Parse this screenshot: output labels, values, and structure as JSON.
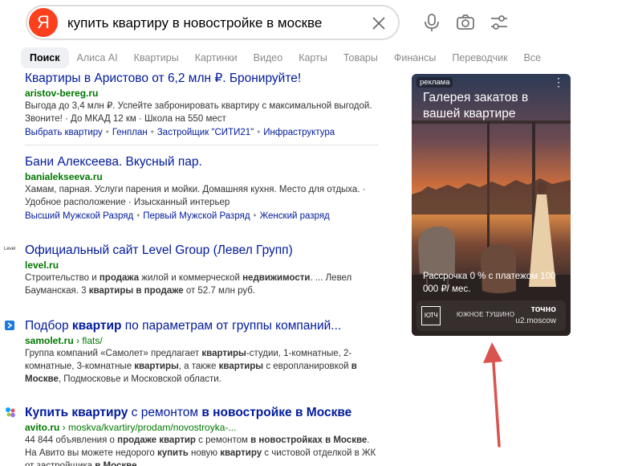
{
  "search": {
    "logo_letter": "Я",
    "query": "купить квартиру в новостройке в москве"
  },
  "tabs": [
    {
      "label": "Поиск",
      "active": true
    },
    {
      "label": "Алиса AI"
    },
    {
      "label": "Квартиры"
    },
    {
      "label": "Картинки"
    },
    {
      "label": "Видео"
    },
    {
      "label": "Карты"
    },
    {
      "label": "Товары"
    },
    {
      "label": "Финансы"
    },
    {
      "label": "Переводчик"
    },
    {
      "label": "Все"
    }
  ],
  "results": [
    {
      "title": "Квартиры в Аристово от 6,2 млн ₽. Бронируйте!",
      "domain": "aristov-bereg.ru",
      "text": "Выгода до 3,4 млн ₽. Успейте забронировать квартиру с максимальной выгодой. Звоните! · До МКАД 12 км · Школа на 550 мест",
      "links": [
        "Выбрать квартиру",
        "Генплан",
        "Застройщик \"СИТИ21\"",
        "Инфраструктура"
      ]
    },
    {
      "title": "Бани Алексеева. Вкусный пар.",
      "domain": "banialekseeva.ru",
      "text": "Хамам, парная. Услуги парения и мойки. Домашняя кухня. Место для отдыха. · Удобное расположение · Изысканный интерьер",
      "links": [
        "Высший Мужской Разряд",
        "Первый Мужской Разряд",
        "Женский разряд"
      ]
    },
    {
      "favicon_text": "Level",
      "title": "Официальный сайт Level Group (Левел Групп)",
      "domain": "level.ru",
      "text_parts": [
        {
          "t": "Строительство и "
        },
        {
          "t": "продажа",
          "b": true
        },
        {
          "t": " жилой и коммерческой "
        },
        {
          "t": "недвижимости",
          "b": true
        },
        {
          "t": ". ... Левел Бауманская. 3 "
        },
        {
          "t": "квартиры в продаже",
          "b": true
        },
        {
          "t": " от 52.7 млн руб."
        }
      ]
    },
    {
      "title_parts": [
        {
          "t": "Подбор "
        },
        {
          "t": "квартир",
          "b": true
        },
        {
          "t": " по параметрам от группы компаний..."
        }
      ],
      "domain": "samolet.ru",
      "path": " › flats/",
      "text_parts": [
        {
          "t": "Группа компаний «Самолет» предлагает "
        },
        {
          "t": "квартиры",
          "b": true
        },
        {
          "t": "-студии, 1-комнатные, 2-комнатные, 3-комнатные "
        },
        {
          "t": "квартиры",
          "b": true
        },
        {
          "t": ", а также "
        },
        {
          "t": "квартиры",
          "b": true
        },
        {
          "t": " с европланировкой "
        },
        {
          "t": "в Москве",
          "b": true
        },
        {
          "t": ", Подмосковье и Московской области."
        }
      ]
    },
    {
      "title_parts": [
        {
          "t": "Купить квартиру",
          "b": true
        },
        {
          "t": " с ремонтом "
        },
        {
          "t": "в новостройке в Москве",
          "b": true
        }
      ],
      "domain": "avito.ru",
      "path": " › moskva/kvartiry/prodam/novostroyka-...",
      "text_parts": [
        {
          "t": "44 844 объявления о "
        },
        {
          "t": "продаже квартир",
          "b": true
        },
        {
          "t": " с ремонтом "
        },
        {
          "t": "в новостройках в Москве",
          "b": true
        },
        {
          "t": ". На Авито вы можете недорого "
        },
        {
          "t": "купить",
          "b": true
        },
        {
          "t": " новую "
        },
        {
          "t": "квартиру",
          "b": true
        },
        {
          "t": " с чистовой отделкой в ЖК от застройщика "
        },
        {
          "t": "в Москве",
          "b": true
        },
        {
          "t": "."
        }
      ]
    }
  ],
  "ad": {
    "label": "реклама",
    "menu": "⋮",
    "headline": "Галерея закатов в вашей квартире",
    "offer": "Рассрочка 0 % с платежом 100 000 ₽/ мес.",
    "brand_mark": "ЮТЧ",
    "location": "ЮЖНОЕ ТУШИНО",
    "tag": "точно",
    "domain": "u2.moscow"
  },
  "colors": {
    "link": "#001a9c",
    "url": "#007700",
    "logo": "#fc3f1d",
    "arrow": "#d9534f"
  }
}
